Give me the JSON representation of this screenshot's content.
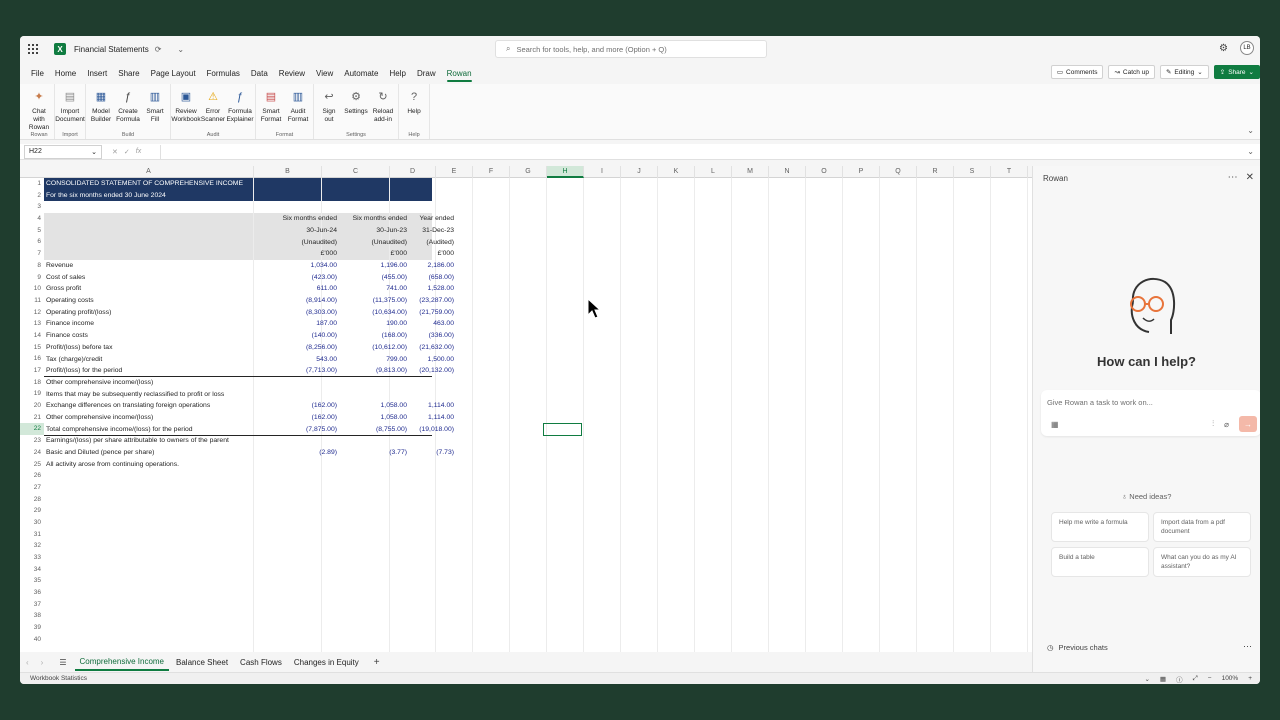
{
  "app": {
    "doc_title": "Financial Statements",
    "search_placeholder": "Search for tools, help, and more (Option + Q)",
    "avatar": "LB"
  },
  "menu": [
    "File",
    "Home",
    "Insert",
    "Share",
    "Page Layout",
    "Formulas",
    "Data",
    "Review",
    "View",
    "Automate",
    "Help",
    "Draw",
    "Rowan"
  ],
  "menu_right": {
    "comments": "Comments",
    "catchup": "Catch up",
    "editing": "Editing",
    "share": "Share"
  },
  "ribbon": {
    "groups": [
      {
        "name": "Rowan",
        "buttons": [
          [
            "Chat with",
            "Rowan"
          ]
        ]
      },
      {
        "name": "Import",
        "buttons": [
          [
            "Import",
            "Document"
          ]
        ]
      },
      {
        "name": "Build",
        "buttons": [
          [
            "Model",
            "Builder"
          ],
          [
            "Create",
            "Formula"
          ],
          [
            "Smart",
            "Fill"
          ]
        ]
      },
      {
        "name": "Audit",
        "buttons": [
          [
            "Review",
            "Workbook"
          ],
          [
            "Error",
            "Scanner"
          ],
          [
            "Formula",
            "Explainer"
          ]
        ]
      },
      {
        "name": "Format",
        "buttons": [
          [
            "Smart",
            "Format"
          ],
          [
            "Audit",
            "Format"
          ]
        ]
      },
      {
        "name": "Settings",
        "buttons": [
          [
            "Sign",
            "out"
          ],
          [
            "Settings",
            ""
          ],
          [
            "Reload",
            "add-in"
          ]
        ]
      },
      {
        "name": "Help",
        "buttons": [
          [
            "Help",
            ""
          ]
        ]
      }
    ]
  },
  "namebox": "H22",
  "columns": [
    "A",
    "B",
    "C",
    "D",
    "E",
    "F",
    "G",
    "H",
    "I",
    "J",
    "K",
    "L",
    "M",
    "N",
    "O",
    "P",
    "Q",
    "R",
    "S",
    "T"
  ],
  "rows": [
    "1",
    "2",
    "3",
    "4",
    "5",
    "6",
    "7",
    "8",
    "9",
    "10",
    "11",
    "12",
    "13",
    "14",
    "15",
    "16",
    "17",
    "18",
    "19",
    "20",
    "21",
    "22",
    "23",
    "24",
    "25",
    "26",
    "27",
    "28",
    "29",
    "30",
    "31",
    "32",
    "33",
    "34",
    "35",
    "36",
    "37",
    "38",
    "39",
    "40"
  ],
  "sheet": {
    "r1": "CONSOLIDATED STATEMENT OF COMPREHENSIVE INCOME",
    "r2": "For the six months ended 30 June 2024",
    "h4": [
      "Six months ended",
      "Six months ended",
      "Year ended"
    ],
    "h5": [
      "30-Jun-24",
      "30-Jun-23",
      "31-Dec-23"
    ],
    "h6": [
      "(Unaudited)",
      "(Unaudited)",
      "(Audited)"
    ],
    "h7": [
      "£'000",
      "£'000",
      "£'000"
    ],
    "lines": [
      [
        "Revenue",
        "1,034.00",
        "1,196.00",
        "2,186.00"
      ],
      [
        "Cost of sales",
        "(423.00)",
        "(455.00)",
        "(658.00)"
      ],
      [
        "Gross profit",
        "611.00",
        "741.00",
        "1,528.00"
      ],
      [
        "Operating costs",
        "(8,914.00)",
        "(11,375.00)",
        "(23,287.00)"
      ],
      [
        "Operating profit/(loss)",
        "(8,303.00)",
        "(10,634.00)",
        "(21,759.00)"
      ],
      [
        "Finance income",
        "187.00",
        "190.00",
        "463.00"
      ],
      [
        "Finance costs",
        "(140.00)",
        "(168.00)",
        "(336.00)"
      ],
      [
        "Profit/(loss) before tax",
        "(8,256.00)",
        "(10,612.00)",
        "(21,632.00)"
      ],
      [
        "Tax (charge)/credit",
        "543.00",
        "799.00",
        "1,500.00"
      ],
      [
        "Profit/(loss) for the period",
        "(7,713.00)",
        "(9,813.00)",
        "(20,132.00)"
      ],
      [
        "Other comprehensive income/(loss)",
        "",
        "",
        ""
      ],
      [
        "Items that may be subsequently reclassified to profit or loss",
        "",
        "",
        ""
      ],
      [
        "Exchange differences on translating foreign operations",
        "(162.00)",
        "1,058.00",
        "1,114.00"
      ],
      [
        "Other comprehensive income/(loss)",
        "(162.00)",
        "1,058.00",
        "1,114.00"
      ],
      [
        "Total comprehensive income/(loss) for the period",
        "(7,875.00)",
        "(8,755.00)",
        "(19,018.00)"
      ],
      [
        "Earnings/(loss) per share attributable to owners of the parent",
        "",
        "",
        ""
      ],
      [
        "Basic and Diluted (pence per share)",
        "(2.89)",
        "(3.77)",
        "(7.73)"
      ],
      [
        "All activity arose from continuing operations.",
        "",
        "",
        ""
      ]
    ]
  },
  "sheet_tabs": [
    "Comprehensive Income",
    "Balance Sheet",
    "Cash Flows",
    "Changes in Equity"
  ],
  "status": {
    "left": "Workbook Statistics",
    "zoom": "100%"
  },
  "pane": {
    "title": "Rowan",
    "help": "How can I help?",
    "prompt_placeholder": "Give Rowan a task to work on...",
    "ideas": "Need ideas?",
    "cards": [
      "Help me write a formula",
      "Import data from a pdf document",
      "Build a table",
      "What can you do as my AI assistant?"
    ],
    "previous": "Previous chats"
  },
  "colors": {
    "accent": "#107c41",
    "header_band": "#1f3864",
    "value_text": "#1f2a8f"
  }
}
